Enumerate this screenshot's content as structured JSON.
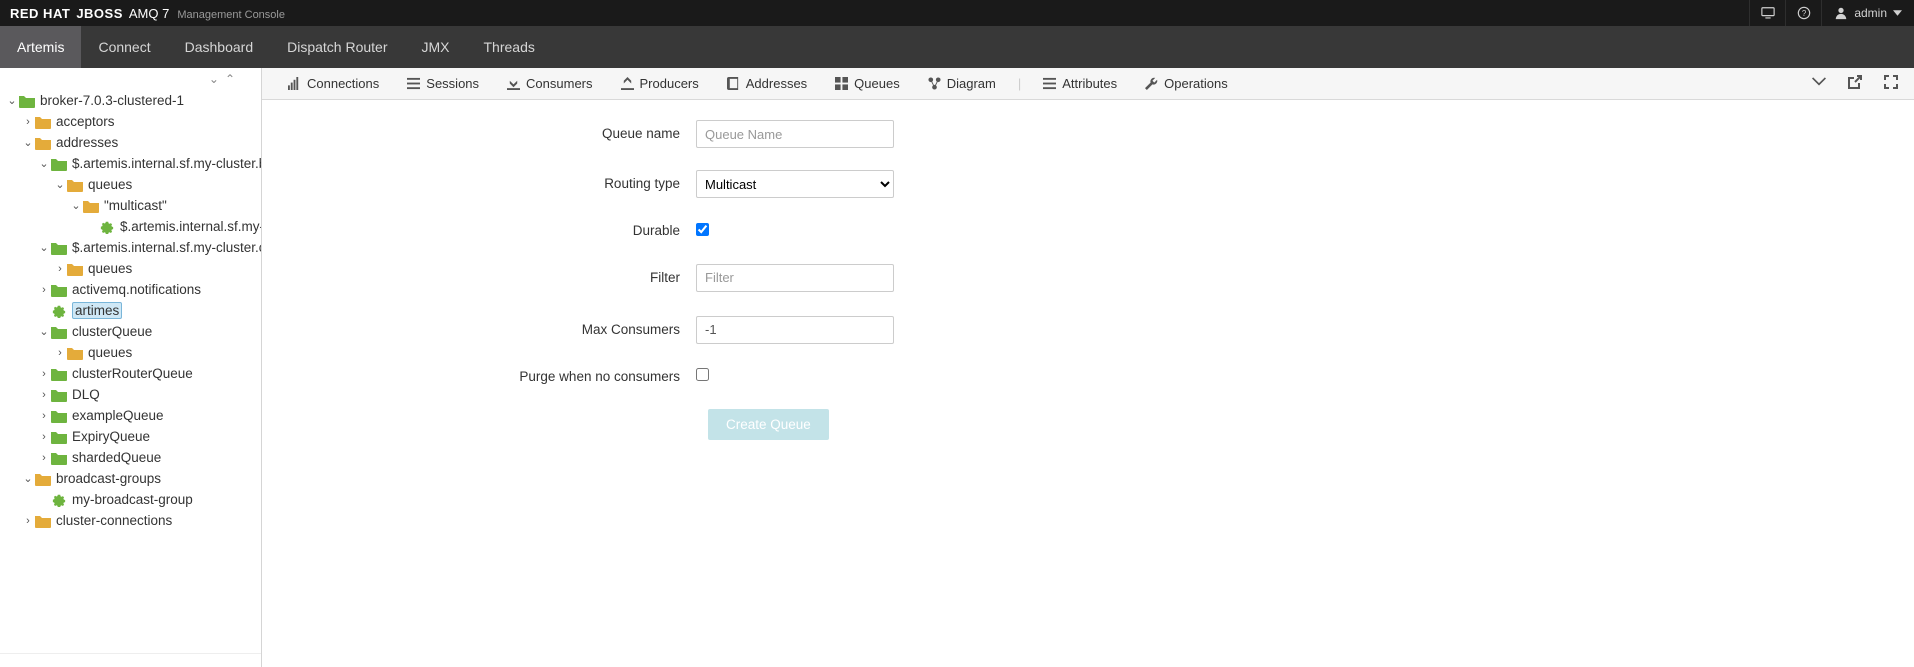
{
  "brand": {
    "red": "RED HAT",
    "jboss": "JBOSS",
    "amq": "AMQ 7",
    "subtitle": "Management Console"
  },
  "user": {
    "name": "admin"
  },
  "nav": {
    "items": [
      "Artemis",
      "Connect",
      "Dashboard",
      "Dispatch Router",
      "JMX",
      "Threads"
    ],
    "active": "Artemis"
  },
  "tree": {
    "root": "broker-7.0.3-clustered-1",
    "nodes": {
      "acceptors": "acceptors",
      "addresses": "addresses",
      "artemis_sf_b": "$.artemis.internal.sf.my-cluster.b",
      "queues1": "queues",
      "multicast": "\"multicast\"",
      "artemis_sf_leaf": "$.artemis.internal.sf.my-c",
      "artemis_sf_c": "$.artemis.internal.sf.my-cluster.c",
      "queues2": "queues",
      "activemq_notifications": "activemq.notifications",
      "artimes": "artimes",
      "clusterQueue": "clusterQueue",
      "queues3": "queues",
      "clusterRouterQueue": "clusterRouterQueue",
      "dlq": "DLQ",
      "exampleQueue": "exampleQueue",
      "expiryQueue": "ExpiryQueue",
      "shardedQueue": "shardedQueue",
      "broadcast_groups": "broadcast-groups",
      "my_broadcast_group": "my-broadcast-group",
      "cluster_connections": "cluster-connections"
    }
  },
  "tabs": {
    "connections": "Connections",
    "sessions": "Sessions",
    "consumers": "Consumers",
    "producers": "Producers",
    "addresses": "Addresses",
    "queues": "Queues",
    "diagram": "Diagram",
    "attributes": "Attributes",
    "operations": "Operations"
  },
  "form": {
    "queue_name_label": "Queue name",
    "queue_name_placeholder": "Queue Name",
    "queue_name_value": "",
    "routing_type_label": "Routing type",
    "routing_type_value": "Multicast",
    "durable_label": "Durable",
    "durable_checked": true,
    "filter_label": "Filter",
    "filter_placeholder": "Filter",
    "filter_value": "",
    "max_consumers_label": "Max Consumers",
    "max_consumers_value": "-1",
    "purge_label": "Purge when no consumers",
    "purge_checked": false,
    "submit_label": "Create Queue"
  }
}
